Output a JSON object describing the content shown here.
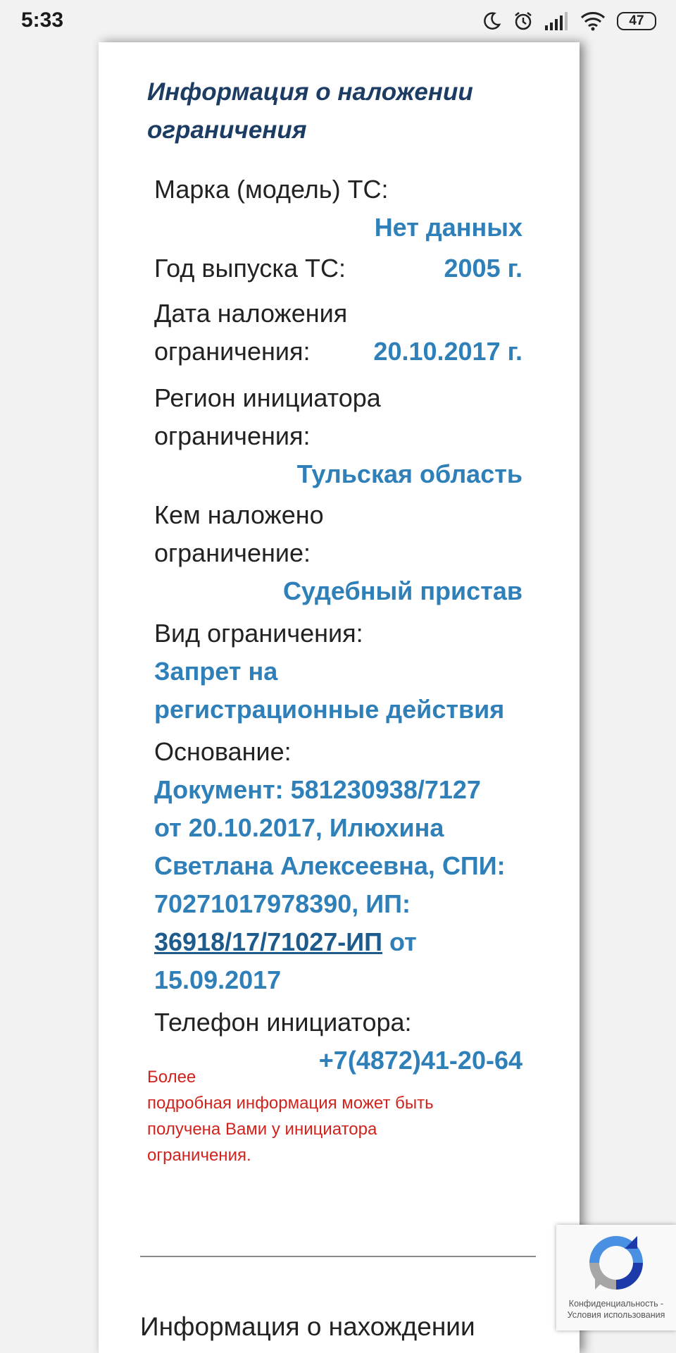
{
  "status_bar": {
    "time": "5:33",
    "battery": "47",
    "icons": [
      "moon-icon",
      "alarm-icon",
      "signal-icon",
      "wifi-icon",
      "battery-icon"
    ]
  },
  "section": {
    "title": "Информация о наложении ограничения"
  },
  "fields": {
    "model_label": "Марка (модель) ТС:",
    "model_value": "Нет данных",
    "year_label": "Год выпуска ТС:",
    "year_value": "2005 г.",
    "date_label_1": "Дата наложения",
    "date_label_2": "ограничения:",
    "date_value": "20.10.2017 г.",
    "region_label_1": "Регион инициатора",
    "region_label_2": "ограничения:",
    "region_value": "Тульская область",
    "who_label_1": "Кем наложено",
    "who_label_2": "ограничение:",
    "who_value": "Судебный пристав",
    "type_label": "Вид ограничения:",
    "type_value_1": "Запрет на",
    "type_value_2": "регистрационные действия",
    "basis_label": "Основание:",
    "basis_1": "Документ: 581230938/7127",
    "basis_2": "от 20.10.2017, Илюхина",
    "basis_3": "Светлана Алексеевна, СПИ:",
    "basis_4": "70271017978390, ИП:",
    "basis_link": "36918/17/71027-ИП",
    "basis_5_suffix": " от",
    "basis_6": "15.09.2017",
    "phone_label": "Телефон инициатора:",
    "phone_value": "+7(4872)41-20-64"
  },
  "note": {
    "line1": "Более",
    "line2": "подробная информация может быть",
    "line3": "получена Вами у инициатора",
    "line4": "ограничения."
  },
  "next_section": {
    "heading": "Информация о нахождении"
  },
  "recaptcha": {
    "footer_1": "Конфиденциальность -",
    "footer_2": "Условия использования"
  },
  "colors": {
    "value_blue": "#2f7fb8",
    "title_navy": "#1c3c63",
    "note_red": "#d0231d"
  }
}
